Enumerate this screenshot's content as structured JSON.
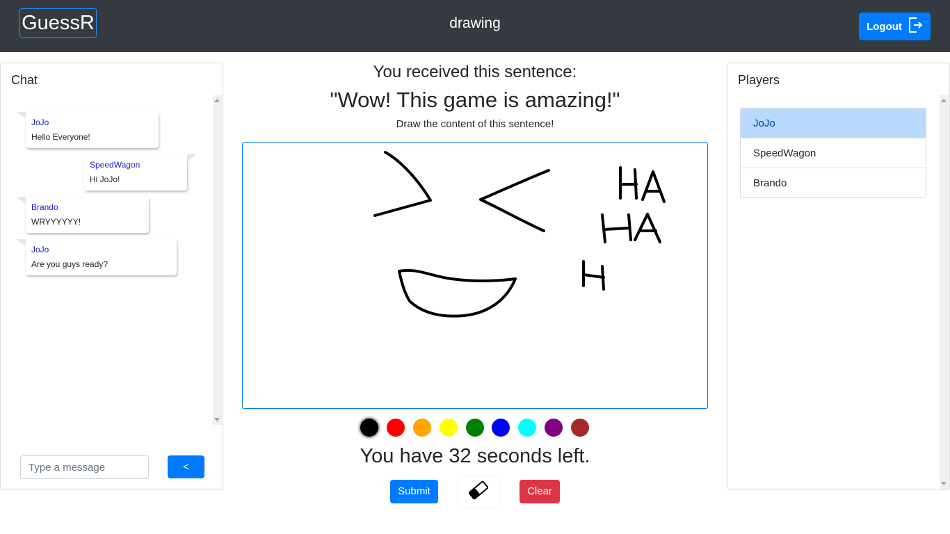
{
  "navbar": {
    "brand": "GuessR",
    "title": "drawing",
    "logout_label": "Logout",
    "logout_icon": "box-arrow-right-icon"
  },
  "chat": {
    "title": "Chat",
    "messages": [
      {
        "user": "JoJo",
        "text": "Hello Everyone!",
        "side": "left"
      },
      {
        "user": "SpeedWagon",
        "text": "Hi JoJo!",
        "side": "right"
      },
      {
        "user": "Brando",
        "text": "WRYYYYYY!",
        "side": "left"
      },
      {
        "user": "JoJo",
        "text": "Are you guys ready?",
        "side": "left"
      }
    ],
    "input_placeholder": "Type a message",
    "send_label": "<"
  },
  "main": {
    "received_label": "You received this sentence:",
    "sentence": "\"Wow! This game is amazing!\"",
    "instruction": "Draw the content of this sentence!",
    "palette": [
      "#000000",
      "#ff0000",
      "#ffa500",
      "#ffff00",
      "#008000",
      "#0000ff",
      "#00ffff",
      "#800080",
      "#a52a2a"
    ],
    "selected_color": "#000000",
    "timer_text": "You have 32 seconds left.",
    "submit_label": "Submit",
    "eraser_icon": "eraser-icon",
    "clear_label": "Clear"
  },
  "players": {
    "title": "Players",
    "list": [
      {
        "name": "JoJo",
        "active": true
      },
      {
        "name": "SpeedWagon",
        "active": false
      },
      {
        "name": "Brando",
        "active": false
      }
    ]
  }
}
